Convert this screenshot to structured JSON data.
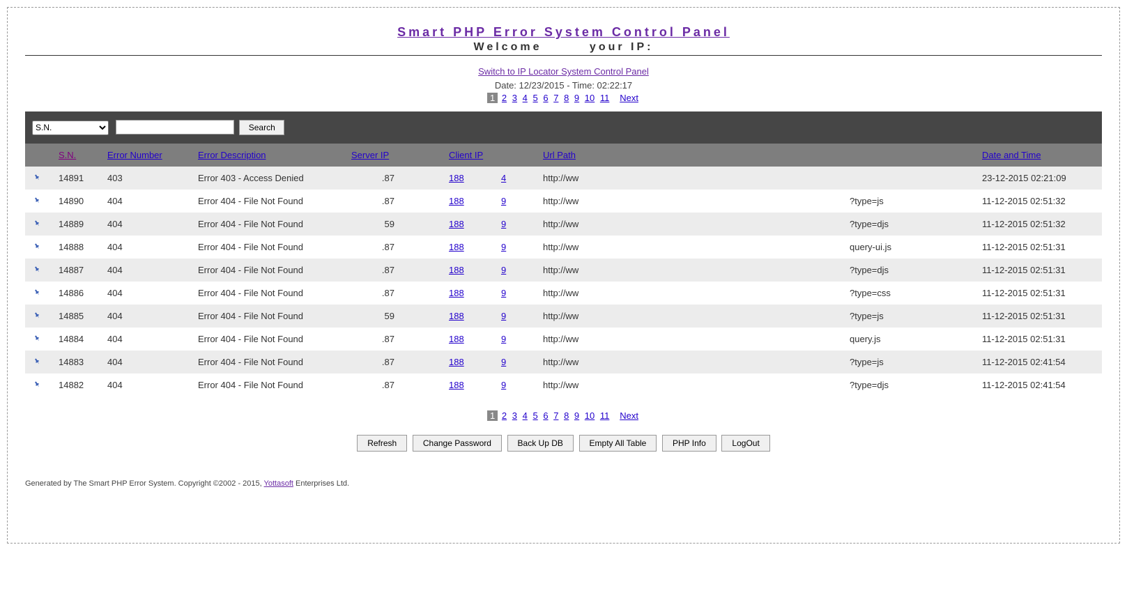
{
  "title": "Smart PHP Error System Control Panel",
  "welcome": {
    "label1": "Welcome",
    "label2": "your IP:"
  },
  "switch_link": "Switch to IP Locator System Control Panel",
  "datetime": "Date: 12/23/2015 - Time: 02:22:17",
  "pager": {
    "current": "1",
    "pages": [
      "2",
      "3",
      "4",
      "5",
      "6",
      "7",
      "8",
      "9",
      "10",
      "11"
    ],
    "next": "Next"
  },
  "search": {
    "dropdown_selected": "S.N.",
    "button": "Search"
  },
  "columns": {
    "sn": "S.N.",
    "errnum": "Error Number",
    "errdesc": "Error Description",
    "serverip": "Server IP",
    "clientip": "Client IP",
    "urlpath": "Url Path",
    "datetime": "Date and Time"
  },
  "rows": [
    {
      "sn": "14891",
      "errnum": "403",
      "errdesc": "Error 403 - Access Denied",
      "serverip": ".87",
      "clientip1": "188",
      "clientip2": "4",
      "url1": "http://ww",
      "url2": "",
      "dt": "23-12-2015 02:21:09"
    },
    {
      "sn": "14890",
      "errnum": "404",
      "errdesc": "Error 404 - File Not Found",
      "serverip": ".87",
      "clientip1": "188",
      "clientip2": "9",
      "url1": "http://ww",
      "url2": "?type=js",
      "dt": "11-12-2015 02:51:32"
    },
    {
      "sn": "14889",
      "errnum": "404",
      "errdesc": "Error 404 - File Not Found",
      "serverip": "59",
      "clientip1": "188",
      "clientip2": "9",
      "url1": "http://ww",
      "url2": "?type=djs",
      "dt": "11-12-2015 02:51:32"
    },
    {
      "sn": "14888",
      "errnum": "404",
      "errdesc": "Error 404 - File Not Found",
      "serverip": ".87",
      "clientip1": "188",
      "clientip2": "9",
      "url1": "http://ww",
      "url2": "query-ui.js",
      "dt": "11-12-2015 02:51:31"
    },
    {
      "sn": "14887",
      "errnum": "404",
      "errdesc": "Error 404 - File Not Found",
      "serverip": ".87",
      "clientip1": "188",
      "clientip2": "9",
      "url1": "http://ww",
      "url2": "?type=djs",
      "dt": "11-12-2015 02:51:31"
    },
    {
      "sn": "14886",
      "errnum": "404",
      "errdesc": "Error 404 - File Not Found",
      "serverip": ".87",
      "clientip1": "188",
      "clientip2": "9",
      "url1": "http://ww",
      "url2": "?type=css",
      "dt": "11-12-2015 02:51:31"
    },
    {
      "sn": "14885",
      "errnum": "404",
      "errdesc": "Error 404 - File Not Found",
      "serverip": "59",
      "clientip1": "188",
      "clientip2": "9",
      "url1": "http://ww",
      "url2": "?type=js",
      "dt": "11-12-2015 02:51:31"
    },
    {
      "sn": "14884",
      "errnum": "404",
      "errdesc": "Error 404 - File Not Found",
      "serverip": ".87",
      "clientip1": "188",
      "clientip2": "9",
      "url1": "http://ww",
      "url2": "query.js",
      "dt": "11-12-2015 02:51:31"
    },
    {
      "sn": "14883",
      "errnum": "404",
      "errdesc": "Error 404 - File Not Found",
      "serverip": ".87",
      "clientip1": "188",
      "clientip2": "9",
      "url1": "http://ww",
      "url2": "?type=js",
      "dt": "11-12-2015 02:41:54"
    },
    {
      "sn": "14882",
      "errnum": "404",
      "errdesc": "Error 404 - File Not Found",
      "serverip": ".87",
      "clientip1": "188",
      "clientip2": "9",
      "url1": "http://ww",
      "url2": "?type=djs",
      "dt": "11-12-2015 02:41:54"
    }
  ],
  "buttons": {
    "refresh": "Refresh",
    "change_pw": "Change Password",
    "backup": "Back Up DB",
    "empty": "Empty All Table",
    "phpinfo": "PHP Info",
    "logout": "LogOut"
  },
  "footer": {
    "text1": "Generated by The Smart PHP Error System. Copyright ©2002 - 2015, ",
    "link": "Yottasoft",
    "text2": " Enterprises Ltd."
  }
}
